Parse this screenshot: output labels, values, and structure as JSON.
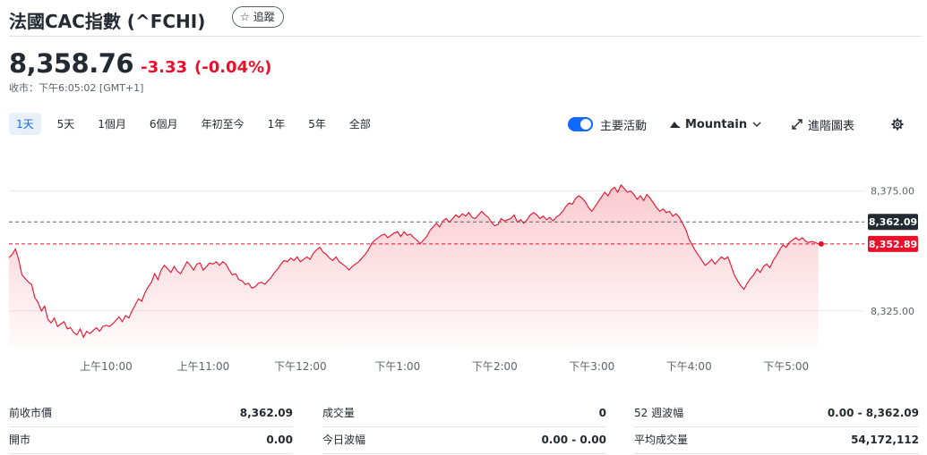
{
  "header": {
    "title": "法國CAC指數 (^FCHI)",
    "follow_label": "追蹤"
  },
  "quote": {
    "price": "8,358.76",
    "change": "-3.33",
    "change_pct": "(-0.04%)",
    "market_time": "收市：下午6:05:02 [GMT+1]"
  },
  "range_tabs": [
    "1天",
    "5天",
    "1個月",
    "6個月",
    "年初至今",
    "1年",
    "5年",
    "全部"
  ],
  "active_range": "1天",
  "controls": {
    "key_events_label": "主要活動",
    "key_events_on": true,
    "chart_type_label": "Mountain",
    "advanced_chart_label": "進階圖表"
  },
  "colors": {
    "down": "#eb0f29",
    "accent": "#0f69ff",
    "text": "#232a31",
    "muted": "#5b636a",
    "prev_close_badge": "#232a31"
  },
  "chart_data": {
    "type": "area",
    "x_ticks": [
      "上午10:00",
      "上午11:00",
      "下午12:00",
      "下午1:00",
      "下午2:00",
      "下午3:00",
      "下午4:00",
      "下午5:00"
    ],
    "y_ticks": [
      "8,375.00",
      "8,325.00"
    ],
    "y_tick_values": [
      8375,
      8325
    ],
    "ylim": [
      8310,
      8392
    ],
    "x_range": [
      "09:00",
      "17:40"
    ],
    "prev_close": 8362.09,
    "prev_close_label": "8,362.09",
    "last_price": 8352.89,
    "last_label": "8,352.89",
    "series": [
      {
        "values": [
          [
            "09:00",
            8347.2
          ],
          [
            "09:02",
            8348.5
          ],
          [
            "09:04",
            8350.8
          ],
          [
            "09:06",
            8346.5
          ],
          [
            "09:08",
            8340.0
          ],
          [
            "09:10",
            8338.5
          ],
          [
            "09:12",
            8337.0
          ],
          [
            "09:14",
            8336.0
          ],
          [
            "09:16",
            8330.5
          ],
          [
            "09:18",
            8328.5
          ],
          [
            "09:20",
            8325.0
          ],
          [
            "09:22",
            8327.0
          ],
          [
            "09:24",
            8321.5
          ],
          [
            "09:26",
            8320.0
          ],
          [
            "09:28",
            8322.0
          ],
          [
            "09:30",
            8318.5
          ],
          [
            "09:32",
            8319.5
          ],
          [
            "09:34",
            8320.5
          ],
          [
            "09:36",
            8317.5
          ],
          [
            "09:38",
            8318.0
          ],
          [
            "09:40",
            8316.0
          ],
          [
            "09:42",
            8315.0
          ],
          [
            "09:44",
            8317.5
          ],
          [
            "09:46",
            8314.0
          ],
          [
            "09:48",
            8316.5
          ],
          [
            "09:50",
            8315.5
          ],
          [
            "09:52",
            8316.8
          ],
          [
            "09:54",
            8318.0
          ],
          [
            "09:56",
            8316.5
          ],
          [
            "09:58",
            8318.5
          ],
          [
            "10:00",
            8319.0
          ],
          [
            "10:02",
            8318.5
          ],
          [
            "10:04",
            8319.5
          ],
          [
            "10:06",
            8321.0
          ],
          [
            "10:08",
            8322.5
          ],
          [
            "10:10",
            8320.5
          ],
          [
            "10:12",
            8323.0
          ],
          [
            "10:14",
            8322.0
          ],
          [
            "10:16",
            8325.0
          ],
          [
            "10:18",
            8327.5
          ],
          [
            "10:20",
            8330.0
          ],
          [
            "10:22",
            8329.0
          ],
          [
            "10:24",
            8332.5
          ],
          [
            "10:26",
            8335.0
          ],
          [
            "10:28",
            8337.0
          ],
          [
            "10:30",
            8340.5
          ],
          [
            "10:32",
            8338.0
          ],
          [
            "10:34",
            8342.0
          ],
          [
            "10:36",
            8344.0
          ],
          [
            "10:38",
            8342.5
          ],
          [
            "10:40",
            8341.0
          ],
          [
            "10:42",
            8343.5
          ],
          [
            "10:44",
            8341.5
          ],
          [
            "10:46",
            8340.5
          ],
          [
            "10:48",
            8343.0
          ],
          [
            "10:50",
            8345.5
          ],
          [
            "10:52",
            8344.0
          ],
          [
            "10:54",
            8342.0
          ],
          [
            "10:56",
            8344.5
          ],
          [
            "10:58",
            8345.0
          ],
          [
            "11:00",
            8342.0
          ],
          [
            "11:02",
            8343.5
          ],
          [
            "11:04",
            8345.0
          ],
          [
            "11:06",
            8344.5
          ],
          [
            "11:08",
            8345.5
          ],
          [
            "11:10",
            8344.0
          ],
          [
            "11:12",
            8345.5
          ],
          [
            "11:14",
            8344.5
          ],
          [
            "11:16",
            8342.0
          ],
          [
            "11:18",
            8340.0
          ],
          [
            "11:20",
            8340.5
          ],
          [
            "11:22",
            8338.0
          ],
          [
            "11:24",
            8337.5
          ],
          [
            "11:26",
            8336.0
          ],
          [
            "11:28",
            8336.5
          ],
          [
            "11:30",
            8334.5
          ],
          [
            "11:32",
            8335.0
          ],
          [
            "11:34",
            8336.5
          ],
          [
            "11:36",
            8337.0
          ],
          [
            "11:38",
            8336.0
          ],
          [
            "11:40",
            8337.5
          ],
          [
            "11:42",
            8339.0
          ],
          [
            "11:44",
            8341.0
          ],
          [
            "11:46",
            8342.5
          ],
          [
            "11:48",
            8344.5
          ],
          [
            "11:50",
            8346.0
          ],
          [
            "11:52",
            8345.5
          ],
          [
            "11:54",
            8347.0
          ],
          [
            "11:56",
            8346.0
          ],
          [
            "11:58",
            8347.5
          ],
          [
            "12:00",
            8345.5
          ],
          [
            "12:02",
            8346.5
          ],
          [
            "12:04",
            8347.5
          ],
          [
            "12:06",
            8346.5
          ],
          [
            "12:08",
            8349.0
          ],
          [
            "12:10",
            8350.5
          ],
          [
            "12:12",
            8351.5
          ],
          [
            "12:14",
            8349.5
          ],
          [
            "12:16",
            8348.5
          ],
          [
            "12:18",
            8347.0
          ],
          [
            "12:20",
            8346.0
          ],
          [
            "12:22",
            8347.5
          ],
          [
            "12:24",
            8345.5
          ],
          [
            "12:26",
            8344.5
          ],
          [
            "12:28",
            8343.5
          ],
          [
            "12:30",
            8342.0
          ],
          [
            "12:32",
            8343.5
          ],
          [
            "12:34",
            8344.5
          ],
          [
            "12:36",
            8345.5
          ],
          [
            "12:38",
            8347.0
          ],
          [
            "12:40",
            8348.5
          ],
          [
            "12:42",
            8350.5
          ],
          [
            "12:44",
            8353.0
          ],
          [
            "12:46",
            8354.5
          ],
          [
            "12:48",
            8355.5
          ],
          [
            "12:50",
            8356.5
          ],
          [
            "12:52",
            8357.0
          ],
          [
            "12:54",
            8355.5
          ],
          [
            "12:56",
            8356.5
          ],
          [
            "12:58",
            8357.5
          ],
          [
            "13:00",
            8358.0
          ],
          [
            "13:02",
            8356.0
          ],
          [
            "13:04",
            8358.0
          ],
          [
            "13:06",
            8356.5
          ],
          [
            "13:08",
            8357.0
          ],
          [
            "13:10",
            8355.5
          ],
          [
            "13:12",
            8354.5
          ],
          [
            "13:14",
            8353.0
          ],
          [
            "13:16",
            8354.5
          ],
          [
            "13:18",
            8356.0
          ],
          [
            "13:20",
            8358.5
          ],
          [
            "13:22",
            8360.0
          ],
          [
            "13:24",
            8361.5
          ],
          [
            "13:26",
            8360.0
          ],
          [
            "13:28",
            8362.5
          ],
          [
            "13:30",
            8363.5
          ],
          [
            "13:32",
            8362.0
          ],
          [
            "13:34",
            8363.5
          ],
          [
            "13:36",
            8365.0
          ],
          [
            "13:38",
            8364.0
          ],
          [
            "13:40",
            8365.5
          ],
          [
            "13:42",
            8364.5
          ],
          [
            "13:44",
            8366.0
          ],
          [
            "13:46",
            8364.0
          ],
          [
            "13:48",
            8363.5
          ],
          [
            "13:50",
            8365.0
          ],
          [
            "13:52",
            8366.5
          ],
          [
            "13:54",
            8365.0
          ],
          [
            "13:56",
            8364.0
          ],
          [
            "13:58",
            8362.0
          ],
          [
            "14:00",
            8360.5
          ],
          [
            "14:02",
            8361.0
          ],
          [
            "14:04",
            8363.5
          ],
          [
            "14:06",
            8362.5
          ],
          [
            "14:08",
            8363.0
          ],
          [
            "14:10",
            8363.5
          ],
          [
            "14:12",
            8365.0
          ],
          [
            "14:14",
            8362.0
          ],
          [
            "14:16",
            8363.0
          ],
          [
            "14:18",
            8361.5
          ],
          [
            "14:20",
            8363.0
          ],
          [
            "14:22",
            8365.0
          ],
          [
            "14:24",
            8366.0
          ],
          [
            "14:26",
            8365.0
          ],
          [
            "14:28",
            8363.5
          ],
          [
            "14:30",
            8364.5
          ],
          [
            "14:32",
            8363.0
          ],
          [
            "14:34",
            8364.0
          ],
          [
            "14:36",
            8362.5
          ],
          [
            "14:38",
            8364.0
          ],
          [
            "14:40",
            8365.0
          ],
          [
            "14:42",
            8366.5
          ],
          [
            "14:44",
            8368.5
          ],
          [
            "14:46",
            8370.0
          ],
          [
            "14:48",
            8369.5
          ],
          [
            "14:50",
            8372.0
          ],
          [
            "14:52",
            8373.0
          ],
          [
            "14:54",
            8372.0
          ],
          [
            "14:56",
            8370.5
          ],
          [
            "14:58",
            8368.0
          ],
          [
            "15:00",
            8366.5
          ],
          [
            "15:02",
            8368.5
          ],
          [
            "15:04",
            8370.5
          ],
          [
            "15:06",
            8372.5
          ],
          [
            "15:08",
            8374.5
          ],
          [
            "15:10",
            8373.0
          ],
          [
            "15:12",
            8375.5
          ],
          [
            "15:14",
            8376.5
          ],
          [
            "15:16",
            8374.5
          ],
          [
            "15:18",
            8377.5
          ],
          [
            "15:20",
            8376.0
          ],
          [
            "15:22",
            8374.5
          ],
          [
            "15:24",
            8375.0
          ],
          [
            "15:26",
            8373.5
          ],
          [
            "15:28",
            8371.5
          ],
          [
            "15:30",
            8373.0
          ],
          [
            "15:32",
            8371.0
          ],
          [
            "15:34",
            8373.5
          ],
          [
            "15:36",
            8372.0
          ],
          [
            "15:38",
            8370.0
          ],
          [
            "15:40",
            8368.0
          ],
          [
            "15:42",
            8366.5
          ],
          [
            "15:44",
            8367.5
          ],
          [
            "15:46",
            8366.0
          ],
          [
            "15:48",
            8366.5
          ],
          [
            "15:50",
            8364.5
          ],
          [
            "15:52",
            8365.5
          ],
          [
            "15:54",
            8364.0
          ],
          [
            "15:56",
            8361.5
          ],
          [
            "15:58",
            8359.0
          ],
          [
            "16:00",
            8355.0
          ],
          [
            "16:02",
            8352.5
          ],
          [
            "16:04",
            8350.0
          ],
          [
            "16:06",
            8348.0
          ],
          [
            "16:08",
            8346.0
          ],
          [
            "16:10",
            8344.0
          ],
          [
            "16:12",
            8345.0
          ],
          [
            "16:14",
            8346.5
          ],
          [
            "16:16",
            8344.5
          ],
          [
            "16:18",
            8346.0
          ],
          [
            "16:20",
            8347.5
          ],
          [
            "16:22",
            8346.5
          ],
          [
            "16:24",
            8347.5
          ],
          [
            "16:26",
            8344.0
          ],
          [
            "16:28",
            8340.0
          ],
          [
            "16:30",
            8337.5
          ],
          [
            "16:32",
            8335.5
          ],
          [
            "16:34",
            8334.0
          ],
          [
            "16:36",
            8336.5
          ],
          [
            "16:38",
            8338.5
          ],
          [
            "16:40",
            8340.0
          ],
          [
            "16:42",
            8342.5
          ],
          [
            "16:44",
            8341.0
          ],
          [
            "16:46",
            8343.5
          ],
          [
            "16:48",
            8344.5
          ],
          [
            "16:50",
            8343.0
          ],
          [
            "16:52",
            8346.0
          ],
          [
            "16:54",
            8348.0
          ],
          [
            "16:56",
            8350.5
          ],
          [
            "16:58",
            8352.5
          ],
          [
            "17:00",
            8351.5
          ],
          [
            "17:02",
            8353.5
          ],
          [
            "17:04",
            8354.5
          ],
          [
            "17:06",
            8355.5
          ],
          [
            "17:08",
            8354.5
          ],
          [
            "17:10",
            8355.5
          ],
          [
            "17:12",
            8354.0
          ],
          [
            "17:14",
            8353.5
          ],
          [
            "17:16",
            8354.0
          ],
          [
            "17:18",
            8353.5
          ],
          [
            "17:20",
            8352.89
          ]
        ]
      }
    ]
  },
  "stats": [
    [
      {
        "label": "前收市價",
        "value": "8,362.09"
      },
      {
        "label": "成交量",
        "value": "0"
      },
      {
        "label": "52 週波幅",
        "value": "0.00 - 8,362.09"
      }
    ],
    [
      {
        "label": "開市",
        "value": "0.00"
      },
      {
        "label": "今日波幅",
        "value": "0.00 - 0.00"
      },
      {
        "label": "平均成交量",
        "value": "54,172,112"
      }
    ]
  ]
}
